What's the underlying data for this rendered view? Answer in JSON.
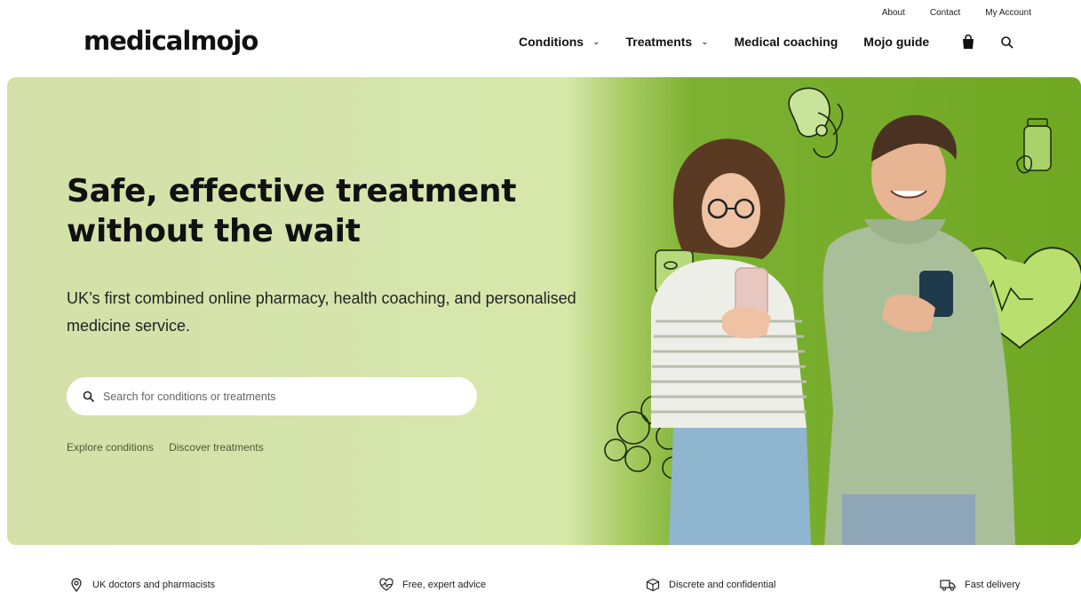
{
  "utility": {
    "about": "About",
    "contact": "Contact",
    "account": "My Account"
  },
  "header": {
    "logo": "medicalmojo",
    "nav": [
      {
        "label": "Conditions",
        "dropdown": true
      },
      {
        "label": "Treatments",
        "dropdown": true
      },
      {
        "label": "Medical coaching",
        "dropdown": false
      },
      {
        "label": "Mojo guide",
        "dropdown": false
      }
    ],
    "icons": [
      "shopping-bag-icon",
      "search-icon"
    ]
  },
  "hero": {
    "title": "Safe, effective treatment without the wait",
    "subtitle": "UK’s first combined online pharmacy, health coaching, and personalised medicine service.",
    "search_placeholder": "Search for conditions or treatments",
    "links": {
      "conditions": "Explore conditions",
      "treatments": "Discover treatments"
    }
  },
  "features": [
    {
      "label": "UK doctors and pharmacists",
      "icon": "location-pin-icon"
    },
    {
      "label": "Free, expert advice",
      "icon": "heartbeat-icon"
    },
    {
      "label": "Discrete and confidential",
      "icon": "box-icon"
    },
    {
      "label": "Fast delivery",
      "icon": "truck-icon"
    }
  ],
  "colors": {
    "hero_light": "#d5e3aa",
    "hero_green": "#6fa823",
    "text": "#111111"
  }
}
